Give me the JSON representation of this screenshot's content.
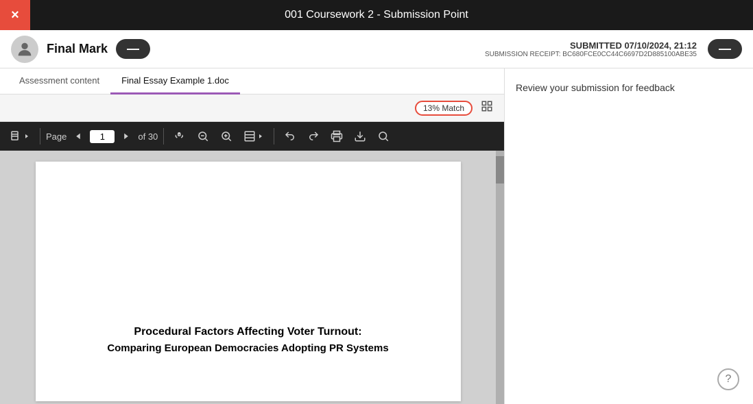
{
  "top_bar": {
    "title": "001 Coursework 2 - Submission Point",
    "close_icon": "×"
  },
  "header": {
    "user_name": "Final Mark",
    "dash_btn_label": "—",
    "submitted_label": "SUBMITTED 07/10/2024, 21:12",
    "receipt_label": "SUBMISSION RECEIPT: BC680FCE0CC44C6697D2D885100ABE35",
    "right_btn_label": "—"
  },
  "tabs": [
    {
      "label": "Assessment content",
      "active": false
    },
    {
      "label": "Final Essay Example 1.doc",
      "active": true
    }
  ],
  "toolbar": {
    "match_badge": "13% Match",
    "layout_icon": "⊞"
  },
  "pdf_toolbar": {
    "page_label": "Page",
    "page_current": "1",
    "page_total": "of 30"
  },
  "document": {
    "title": "Procedural Factors Affecting Voter Turnout:",
    "subtitle": "Comparing European Democracies Adopting PR Systems"
  },
  "right_panel": {
    "review_text": "Review your submission for feedback"
  },
  "help": {
    "icon": "?"
  }
}
